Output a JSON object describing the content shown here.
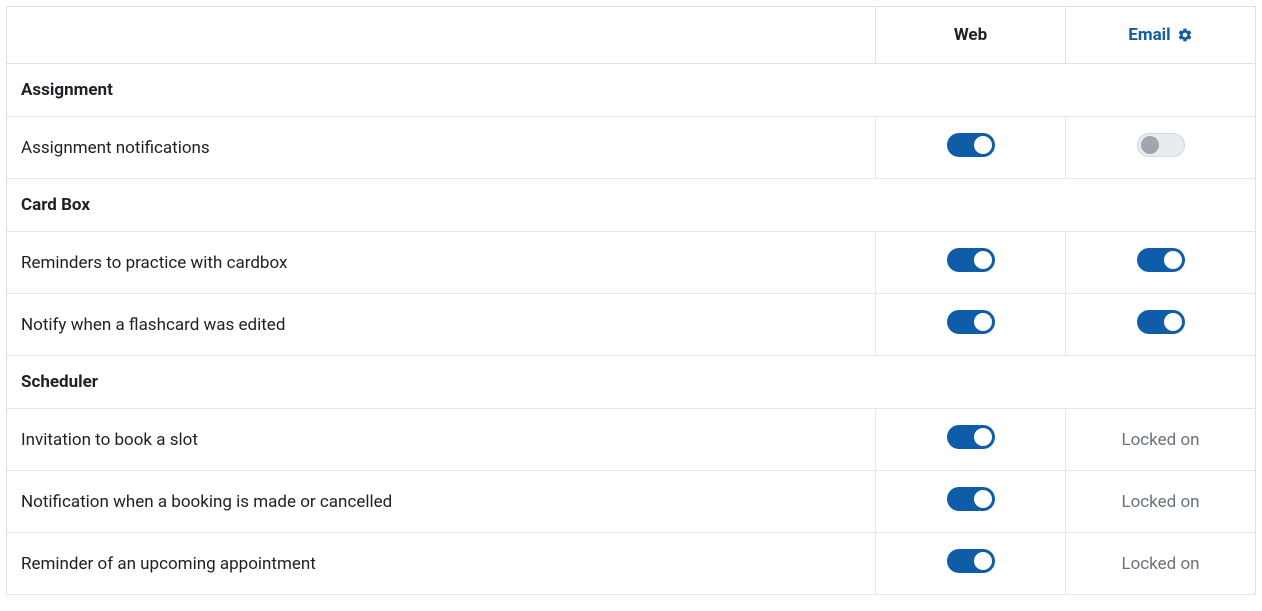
{
  "columns": {
    "name": "",
    "web": "Web",
    "email": "Email"
  },
  "locked_label": "Locked on",
  "groups": [
    {
      "title": "Assignment",
      "rows": [
        {
          "label": "Assignment notifications",
          "web": "on",
          "email": "off"
        }
      ]
    },
    {
      "title": "Card Box",
      "rows": [
        {
          "label": "Reminders to practice with cardbox",
          "web": "on",
          "email": "on"
        },
        {
          "label": "Notify when a flashcard was edited",
          "web": "on",
          "email": "on"
        }
      ]
    },
    {
      "title": "Scheduler",
      "rows": [
        {
          "label": "Invitation to book a slot",
          "web": "on",
          "email": "locked"
        },
        {
          "label": "Notification when a booking is made or cancelled",
          "web": "on",
          "email": "locked"
        },
        {
          "label": "Reminder of an upcoming appointment",
          "web": "on",
          "email": "locked"
        }
      ]
    }
  ]
}
